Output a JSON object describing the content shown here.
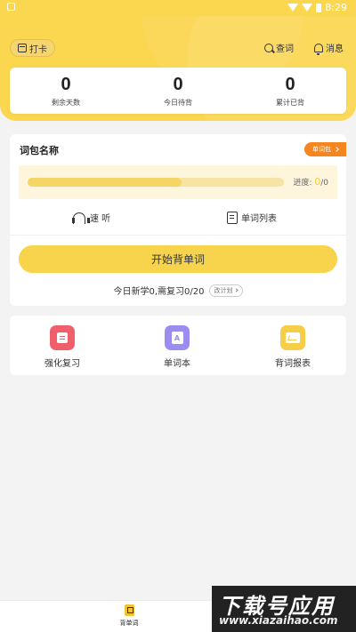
{
  "statusbar": {
    "time": "8:29"
  },
  "header": {
    "checkin_label": "打卡",
    "search_label": "查词",
    "messages_label": "消息"
  },
  "stats": [
    {
      "value": "0",
      "label": "剩余天数"
    },
    {
      "value": "0",
      "label": "今日待背"
    },
    {
      "value": "0",
      "label": "累计已背"
    }
  ],
  "package": {
    "title": "词包名称",
    "badge_label": "单词包",
    "progress_label": "进度:",
    "progress_current": "0",
    "progress_total": "/0",
    "progress_fraction": 0.6
  },
  "quick_actions": {
    "listen_label": "速 听",
    "word_list_label": "单词列表"
  },
  "start_button_label": "开始背单词",
  "plan": {
    "text": "今日新学0,需复习0/20",
    "change_label": "改计划"
  },
  "tools": [
    {
      "label": "强化复习",
      "icon": "review-icon"
    },
    {
      "label": "单词本",
      "icon": "wordbook-icon",
      "glyph": "A"
    },
    {
      "label": "背词报表",
      "icon": "report-icon"
    }
  ],
  "tabbar": {
    "tab_label": "背单词"
  },
  "watermark": {
    "main": "下载号应用",
    "sub": "www.xiazaihao.com"
  },
  "colors": {
    "brand_yellow": "#fbd64f",
    "badge_orange": "#f5861f",
    "review_red": "#f0606a",
    "wordbook_purple": "#9b8cf0"
  }
}
